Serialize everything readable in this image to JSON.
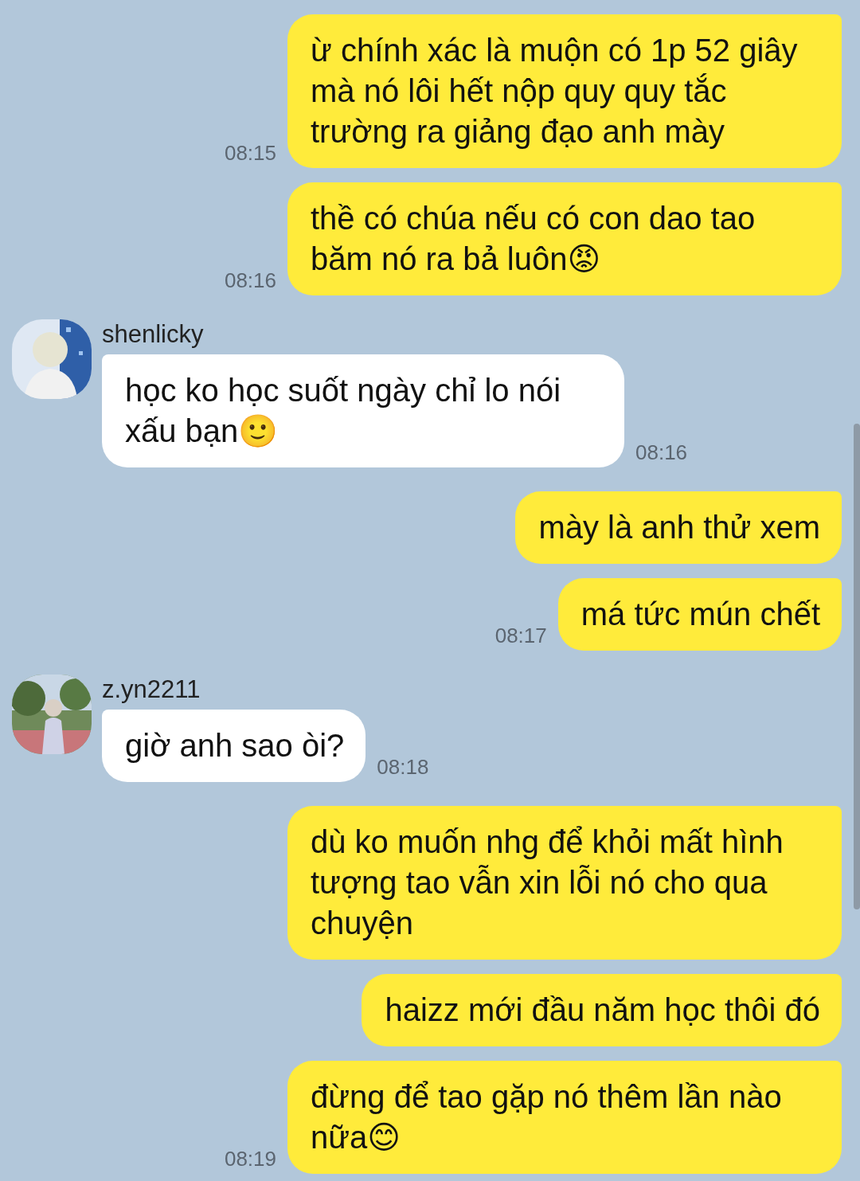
{
  "messages": [
    {
      "kind": "outgoing",
      "text": "ừ chính xác là muộn có 1p 52 giây mà nó lôi hết nộp quy quy tắc trường ra giảng đạo anh mày",
      "time": "08:15"
    },
    {
      "kind": "outgoing",
      "text": "thề có chúa nếu có con dao tao băm nó ra bả luôn😡",
      "time": "08:16"
    },
    {
      "kind": "incoming",
      "sender": "shenlicky",
      "text": "học ko học suốt ngày chỉ lo nói xấu bạn🙂",
      "time": "08:16"
    },
    {
      "kind": "outgoing",
      "text": "mày là anh thử xem"
    },
    {
      "kind": "outgoing",
      "text": "má tức mún chết",
      "time": "08:17"
    },
    {
      "kind": "incoming",
      "sender": "z.yn2211",
      "text": "giờ anh sao òi?",
      "time": "08:18"
    },
    {
      "kind": "outgoing",
      "text": "dù ko muốn nhg để khỏi mất hình tượng tao vẫn xin lỗi nó cho qua chuyện"
    },
    {
      "kind": "outgoing",
      "text": "haizz mới đầu năm học thôi đó"
    },
    {
      "kind": "outgoing",
      "text": "đừng để tao gặp nó thêm lần nào nữa😊",
      "time": "08:19"
    }
  ]
}
